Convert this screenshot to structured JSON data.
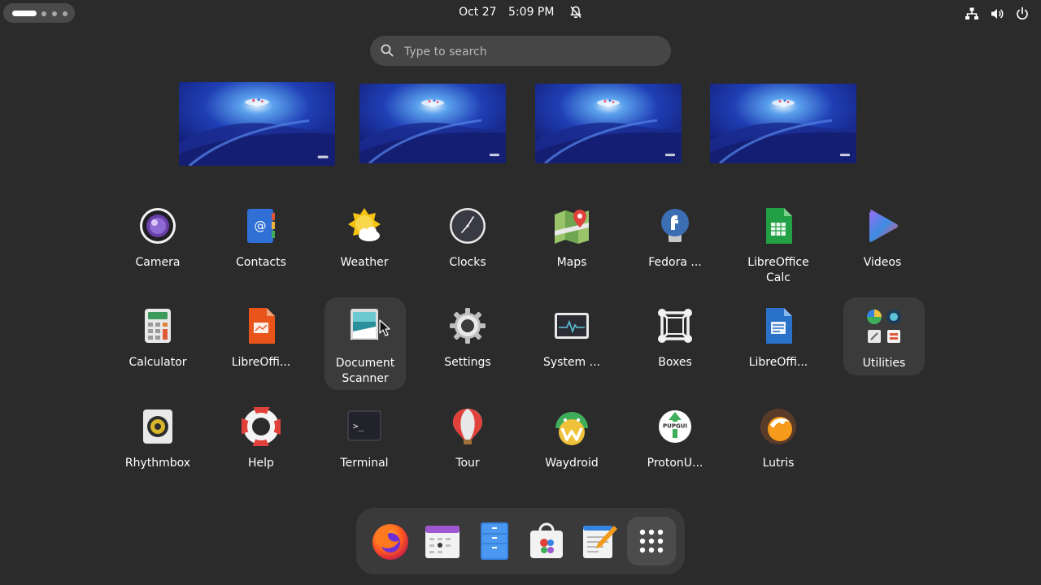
{
  "topbar": {
    "date": "Oct 27",
    "time": "5:09 PM",
    "icons": [
      "activities-indicator",
      "notifications-off-icon",
      "network-icon",
      "volume-icon",
      "power-icon"
    ]
  },
  "search": {
    "placeholder": "Type to search",
    "value": ""
  },
  "workspaces": [
    "workspace-1",
    "workspace-2",
    "workspace-3",
    "workspace-4"
  ],
  "apps": [
    [
      "Camera",
      "Contacts",
      "Weather",
      "Clocks",
      "Maps",
      "Fedora ...",
      "LibreOffice Calc",
      "Videos"
    ],
    [
      "Calculator",
      "LibreOffi...",
      "Document Scanner",
      "Settings",
      "System ...",
      "Boxes",
      "LibreOffi...",
      "Utilities"
    ],
    [
      "Rhythmbox",
      "Help",
      "Terminal",
      "Tour",
      "Waydroid",
      "ProtonU...",
      "Lutris"
    ]
  ],
  "protonup_badge": "PUPGUI",
  "terminal_prompt": ">_",
  "dock": [
    "Firefox",
    "Calendar",
    "Files",
    "Software",
    "Text Editor",
    "Show Apps"
  ],
  "colors": {
    "background": "#2b2b2b",
    "panel": "#3a3a3a",
    "search": "#464646",
    "accent": "#3584e4"
  }
}
